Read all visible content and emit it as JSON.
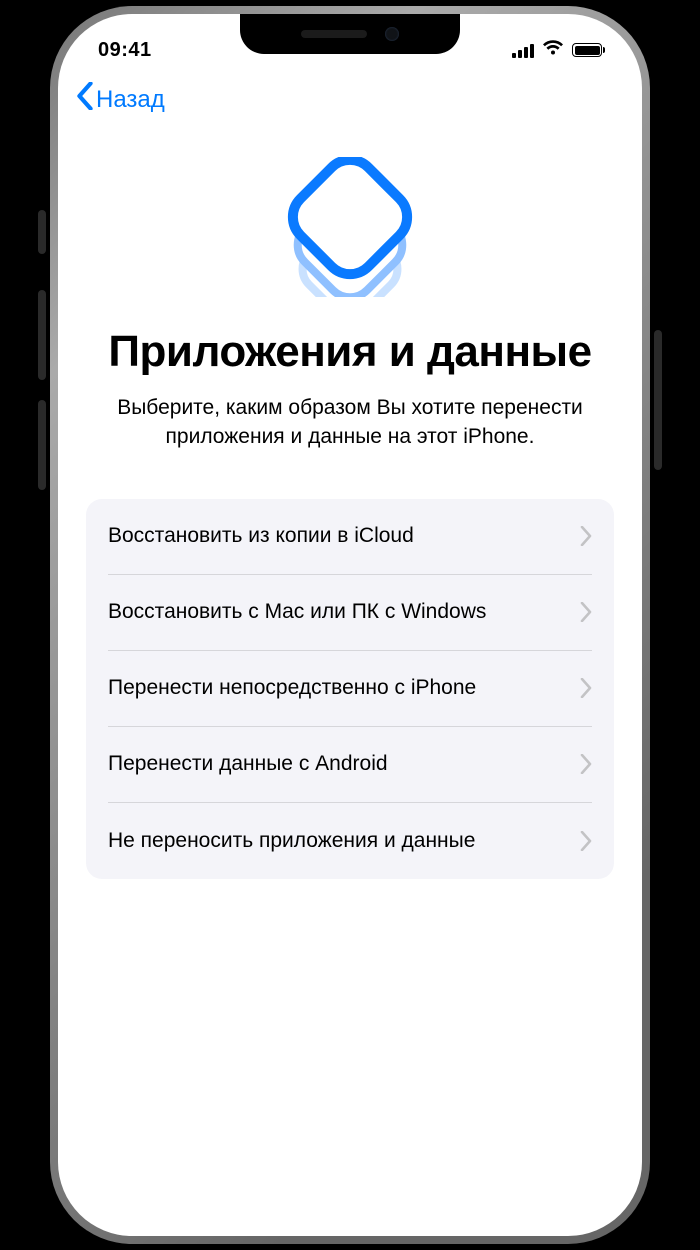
{
  "status": {
    "time": "09:41"
  },
  "nav": {
    "back_label": "Назад"
  },
  "hero": {
    "title": "Приложения и данные",
    "subtitle": "Выберите, каким образом Вы хотите перенести приложения и данные на этот iPhone."
  },
  "options": [
    {
      "label": "Восстановить из копии в iCloud"
    },
    {
      "label": "Восстановить с Mac или ПК с Windows"
    },
    {
      "label": "Перенести непосредственно с iPhone"
    },
    {
      "label": "Перенести данные с Android"
    },
    {
      "label": "Не переносить приложения и данные"
    }
  ],
  "colors": {
    "accent": "#007aff"
  }
}
